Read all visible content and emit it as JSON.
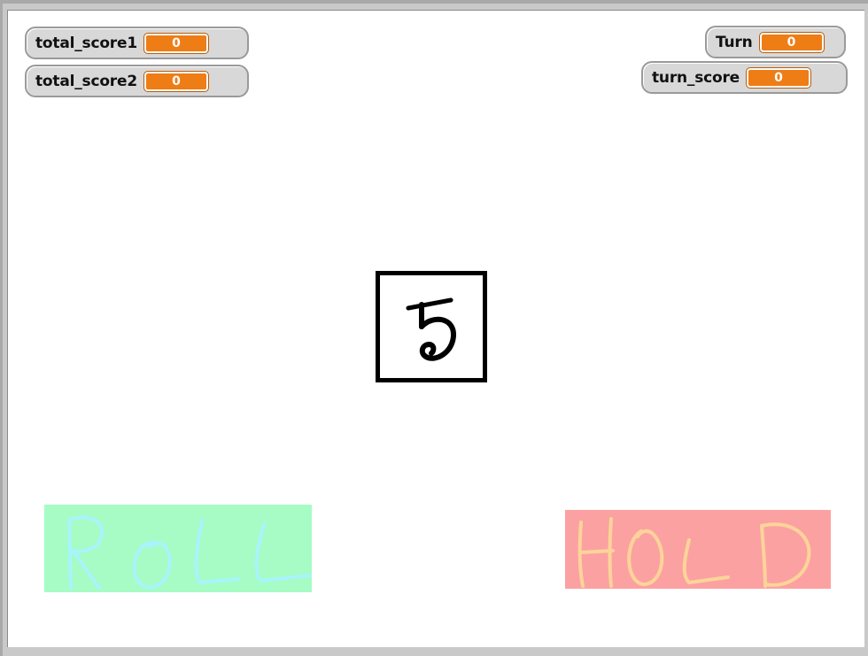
{
  "watchers": [
    {
      "label": "total_score1",
      "value": "0"
    },
    {
      "label": "total_score2",
      "value": "0"
    },
    {
      "label": "Turn",
      "value": "0"
    },
    {
      "label": "turn_score",
      "value": "0"
    }
  ],
  "die": {
    "face": "5"
  },
  "buttons": {
    "roll": {
      "label": "ROLL",
      "color": "#a6fcc4",
      "ink": "#a8f4fc"
    },
    "hold": {
      "label": "HOLD",
      "color": "#fca1a1",
      "ink": "#fcd49a"
    }
  },
  "colors": {
    "watcher_value": "#ee7d16",
    "stage_border": "#c9c9c9"
  }
}
